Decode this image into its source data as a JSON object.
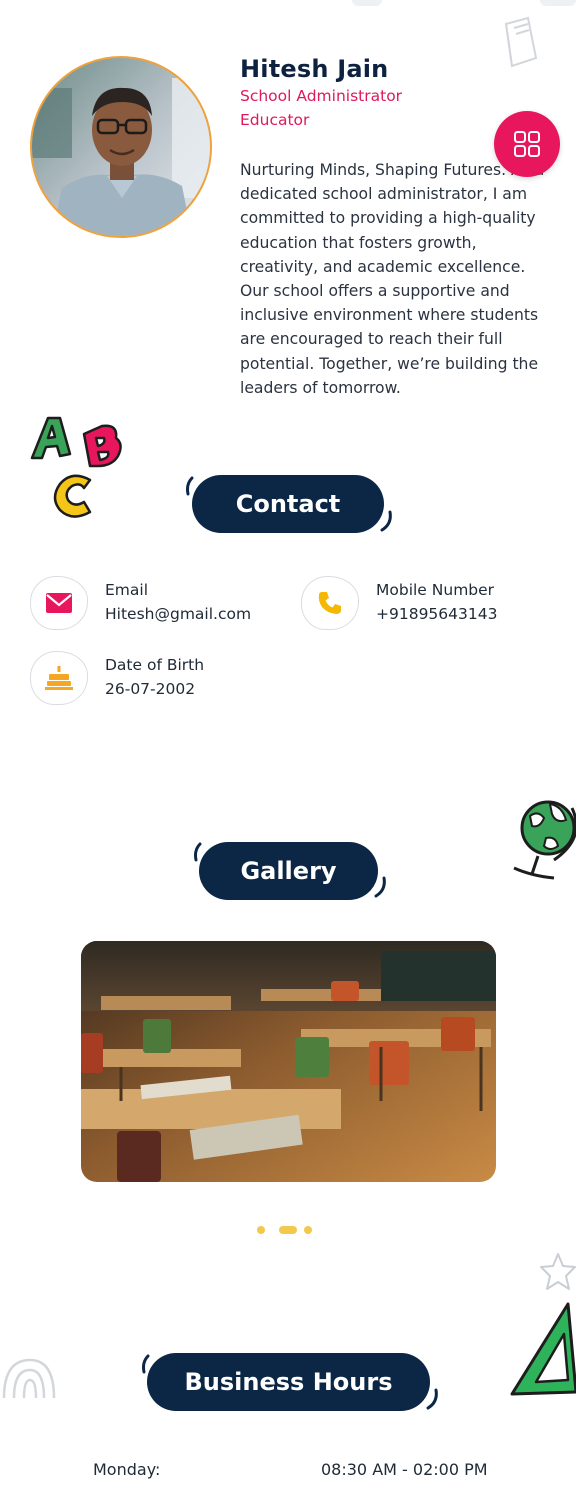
{
  "profile": {
    "name": "Hitesh Jain",
    "role1": "School Administrator",
    "role2": "Educator",
    "bio": "Nurturing Minds, Shaping Futures. As a dedicated school administrator, I am committed to providing a high-quality education that fosters growth, creativity, and academic excellence. Our school offers a supportive and inclusive environment where students are encouraged to reach their full potential. Together, we’re building the leaders of tomorrow."
  },
  "sections": {
    "contact": "Contact",
    "gallery": "Gallery",
    "hours": "Business Hours"
  },
  "contact": {
    "email_label": "Email",
    "email_value": "Hitesh@gmail.com",
    "mobile_label": "Mobile Number",
    "mobile_value": "+91895643143",
    "dob_label": "Date of Birth",
    "dob_value": "26-07-2002"
  },
  "gallery": {
    "slide_count": 3,
    "active_index": 1
  },
  "hours": [
    {
      "day": "Monday:",
      "time": "08:30 AM - 02:00 PM"
    }
  ],
  "colors": {
    "navy": "#0b2745",
    "accent": "#e8175d",
    "avatar_ring": "#f0a13a",
    "dots": "#f2c94c"
  },
  "icons": {
    "fab": "grid-icon",
    "email": "envelope-icon",
    "mobile": "phone-icon",
    "dob": "cake-icon"
  }
}
